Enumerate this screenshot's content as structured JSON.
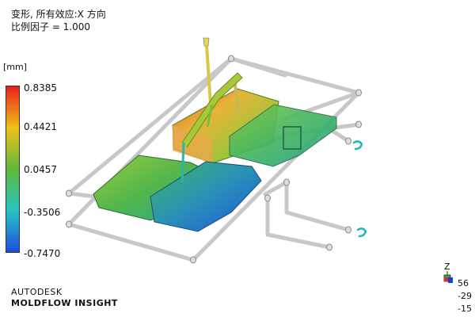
{
  "header": {
    "title": "变形, 所有效应:X 方向",
    "scale": "比例因子 = 1.000"
  },
  "legend": {
    "unit": "[mm]",
    "ticks": [
      "0.8385",
      "0.4421",
      "0.0457",
      "-0.3506",
      "-0.7470"
    ],
    "colors": [
      "#e8201a",
      "#f0c01a",
      "#5dbb3a",
      "#29c4c0",
      "#1e4de0"
    ]
  },
  "brand": {
    "line1": "AUTODESK",
    "line2": "MOLDFLOW INSIGHT"
  },
  "view_axes": {
    "z": "Z",
    "values": [
      "56",
      "-29",
      "-15"
    ]
  }
}
